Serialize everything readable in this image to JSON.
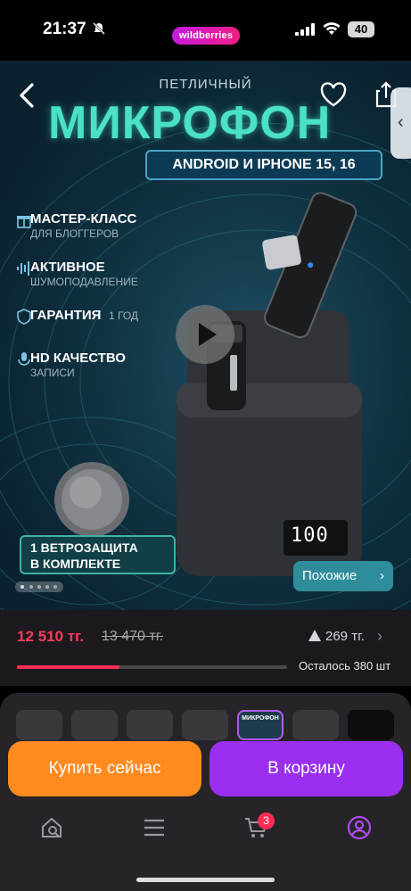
{
  "status_bar": {
    "time": "21:37",
    "app_badge": "wildberries",
    "battery": "40"
  },
  "hero": {
    "small_title": "ПЕТЛИЧНЫЙ",
    "big_title": "МИКРОФОН",
    "model_pill": "ANDROID И IPHONE 15, 16",
    "features": [
      {
        "main": "МАСТЕР-КЛАСС",
        "sub": "ДЛЯ БЛОГГЕРОВ",
        "icon": "gift-icon"
      },
      {
        "main": "АКТИВНОЕ",
        "sub": "ШУМОПОДАВЛЕНИЕ",
        "icon": "waveform-icon"
      },
      {
        "main": "ГАРАНТИЯ",
        "sub": "1 ГОД",
        "icon": "shield-icon"
      },
      {
        "main": "HD КАЧЕСТВО",
        "sub": "ЗАПИСИ",
        "icon": "microphone-icon"
      }
    ],
    "windscreen_line1": "1 ВЕТРОЗАЩИТА",
    "windscreen_line2": "В КОМПЛЕКТЕ",
    "display_digits": "100",
    "similar_label": "Похожие"
  },
  "price": {
    "current": "12 510 тг.",
    "old": "13 470 тг.",
    "cashback": "269 тг.",
    "stock_text": "Осталось 380 шт",
    "stock_fraction": 0.38
  },
  "thumbnail_title": "МИКРОФОН",
  "actions": {
    "buy_now": "Купить сейчас",
    "add_to_cart": "В корзину"
  },
  "bottom_nav": {
    "cart_count": "3"
  },
  "colors": {
    "accent_purple": "#9b2ff0",
    "accent_orange": "#ff8a20",
    "price_red": "#ff3b5c"
  }
}
